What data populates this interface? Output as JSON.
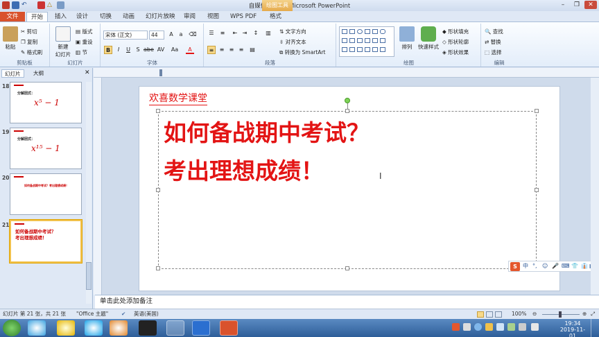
{
  "window": {
    "title": "自媒体10.29 - Microsoft PowerPoint",
    "context_tab": "绘图工具",
    "controls": [
      "–",
      "❐",
      "✕"
    ]
  },
  "tabs": [
    "文件",
    "开始",
    "插入",
    "设计",
    "切换",
    "动画",
    "幻灯片放映",
    "审阅",
    "视图",
    "WPS PDF",
    "格式"
  ],
  "ribbon": {
    "clipboard": {
      "label": "剪贴板",
      "paste": "粘贴",
      "cut": "剪切",
      "copy": "复制",
      "format_painter": "格式刷"
    },
    "slides": {
      "label": "幻灯片",
      "new_slide": "新建",
      "new_slide2": "幻灯片",
      "layout": "版式",
      "reset": "重设",
      "section": "节"
    },
    "font": {
      "label": "字体",
      "name": "宋体 (正文)",
      "size": "44"
    },
    "paragraph": {
      "label": "段落",
      "text_direction": "文字方向",
      "align_text": "对齐文本",
      "smartart": "转换为 SmartArt"
    },
    "drawing": {
      "label": "绘图",
      "arrange": "排列",
      "quick_styles": "快速样式",
      "fill": "形状填充",
      "outline": "形状轮廓",
      "effects": "形状效果"
    },
    "editing": {
      "label": "编辑",
      "find": "查找",
      "replace": "替换",
      "select": "选择"
    }
  },
  "left_pane": {
    "tabs": [
      "幻灯片",
      "大纲"
    ],
    "slides": [
      {
        "num": "18",
        "line1": "分解因式：",
        "formula": "x⁵ − 1"
      },
      {
        "num": "19",
        "line1": "分解因式：",
        "formula": "x¹⁵ − 1"
      },
      {
        "num": "20",
        "line1": "如何备战期中考试？考出理想成绩！"
      },
      {
        "num": "21",
        "line1": "如何备战期中考试？",
        "line2": "考出理想成绩！"
      }
    ]
  },
  "slide": {
    "header": "欢喜数学课堂",
    "line1": "如何备战期中考试？",
    "line2": "考出理想成绩！"
  },
  "notes_placeholder": "单击此处添加备注",
  "status": {
    "slide_info": "幻灯片 第 21 张，共 21 张",
    "theme": "\"Office 主题\"",
    "language": "英语(美国)",
    "zoom": "100%"
  },
  "ime_toolbar": [
    "中",
    "°,",
    "☺",
    "🎤",
    "⌨",
    "👕",
    "👔",
    "▦"
  ],
  "taskbar": {
    "time": "19:34",
    "date": "2019-11-01"
  },
  "colors": {
    "title_red": "#e31414",
    "file_tab": "#d9522c",
    "selection": "#f2c24d"
  }
}
